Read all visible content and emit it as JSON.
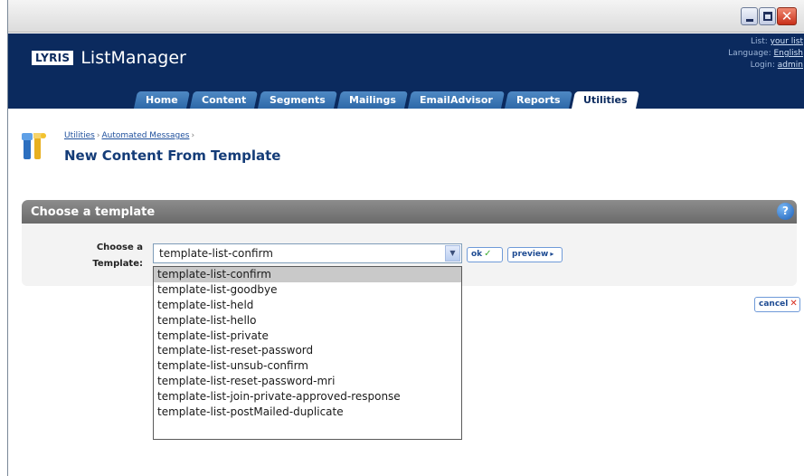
{
  "header": {
    "brand_logo": "LYRIS",
    "brand_name": "ListManager",
    "meta": {
      "list_label": "List:",
      "list_value": "your list",
      "language_label": "Language:",
      "language_value": "English",
      "login_label": "Login:",
      "login_value": "admin"
    },
    "tabs": [
      {
        "label": "Home"
      },
      {
        "label": "Content"
      },
      {
        "label": "Segments"
      },
      {
        "label": "Mailings"
      },
      {
        "label": "EmailAdvisor"
      },
      {
        "label": "Reports"
      },
      {
        "label": "Utilities"
      }
    ],
    "active_tab": "Utilities"
  },
  "breadcrumb": {
    "items": [
      "Utilities",
      "Automated Messages"
    ],
    "separator": "›"
  },
  "page_title": "New Content From Template",
  "panel": {
    "title": "Choose a template",
    "help_label": "?",
    "field_label_line1": "Choose a",
    "field_label_line2": "Template:",
    "select_value": "template-list-confirm",
    "select_arrow": "▼",
    "ok_label": "ok",
    "ok_icon": "✓",
    "preview_label": "preview",
    "preview_icon": "▸"
  },
  "cancel_label": "cancel",
  "cancel_icon": "✕",
  "dropdown": {
    "options": [
      "template-list-confirm",
      "template-list-goodbye",
      "template-list-held",
      "template-list-hello",
      "template-list-private",
      "template-list-reset-password",
      "template-list-unsub-confirm",
      "template-list-reset-password-mri",
      "template-list-join-private-approved-response",
      "template-list-postMailed-duplicate"
    ],
    "selected_index": 0
  },
  "colors": {
    "header_bg": "#0b2a5e",
    "tab_bg": "#2d68a8",
    "panel_head": "#7a7a7a",
    "link": "#1e4f9c"
  }
}
